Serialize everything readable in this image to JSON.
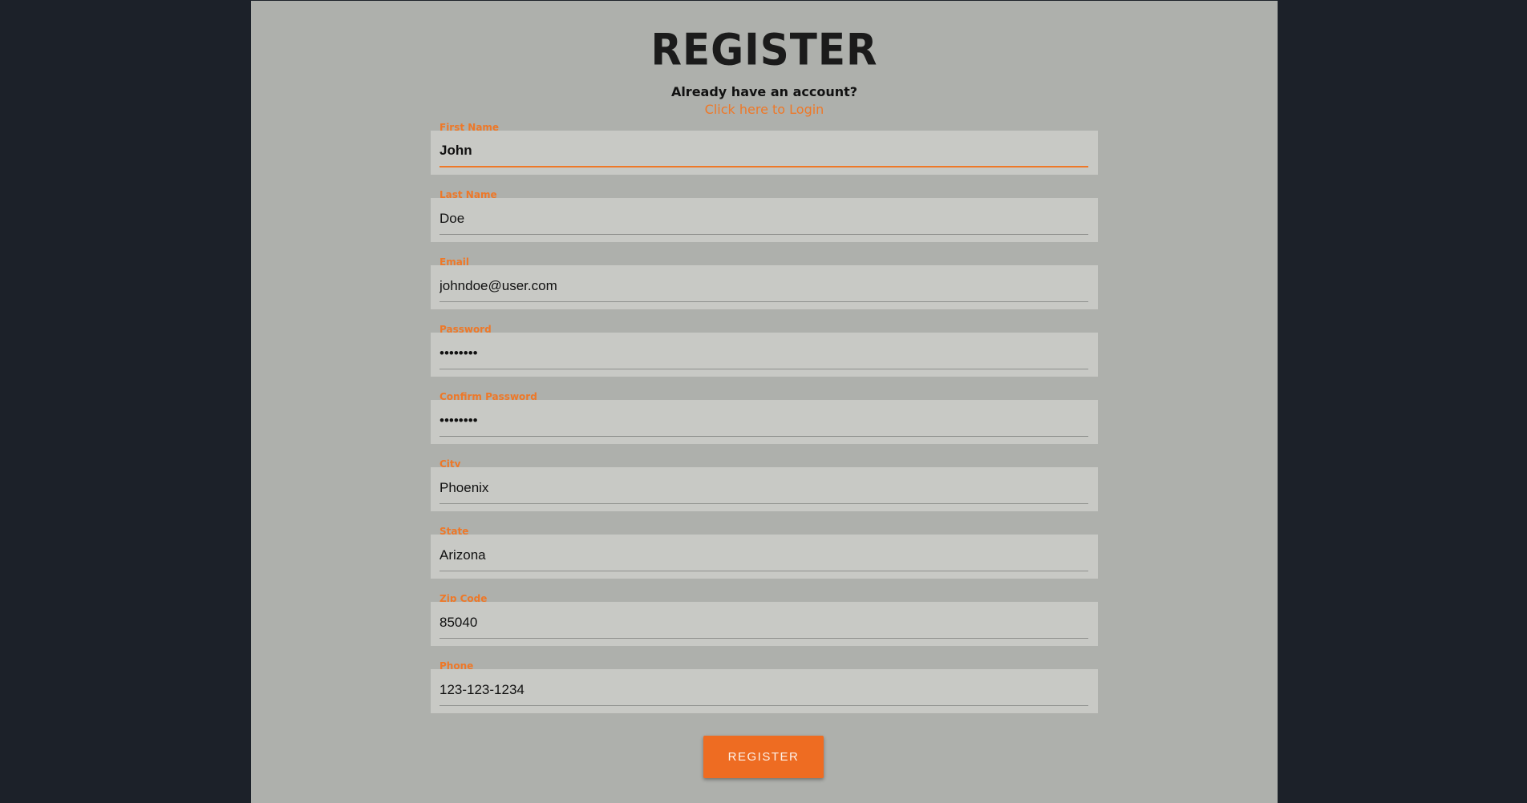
{
  "page": {
    "title": "REGISTER",
    "subtitle": "Already have an account?",
    "login_link": "Click here to Login"
  },
  "fields": [
    {
      "label": "First Name",
      "value": "John",
      "focused": true
    },
    {
      "label": "Last Name",
      "value": "Doe"
    },
    {
      "label": "Email",
      "value": "johndoe@user.com"
    },
    {
      "label": "Password",
      "value": "••••••••",
      "type": "password"
    },
    {
      "label": "Confirm Password",
      "value": "••••••••",
      "type": "password"
    },
    {
      "label": "City",
      "value": "Phoenix"
    },
    {
      "label": "State",
      "value": "Arizona"
    },
    {
      "label": "Zip Code",
      "value": "85040"
    },
    {
      "label": "Phone",
      "value": "123-123-1234"
    }
  ],
  "register_button": {
    "label": "REGISTER"
  },
  "colors": {
    "accent": "#ee7828",
    "button": "#ee6c22",
    "panel": "#aeb0ac",
    "field": "#c8c9c5",
    "background": "#1c2129"
  }
}
